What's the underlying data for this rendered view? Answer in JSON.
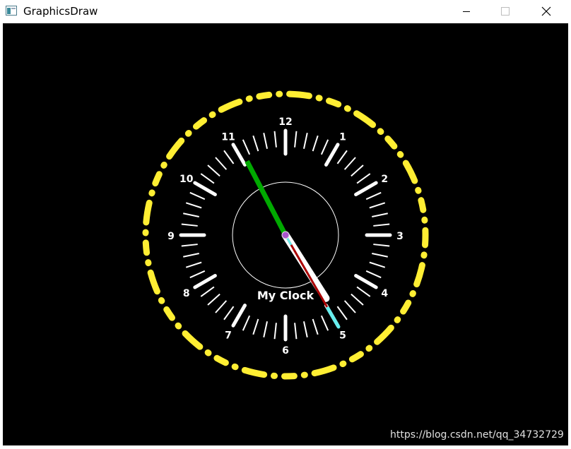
{
  "window": {
    "title": "GraphicsDraw",
    "icon": "app-window-icon",
    "controls": [
      "minimize-icon",
      "maximize-icon",
      "close-icon"
    ]
  },
  "clock": {
    "label": "My Clock",
    "numerals": [
      "12",
      "1",
      "2",
      "3",
      "4",
      "5",
      "6",
      "7",
      "8",
      "9",
      "10",
      "11"
    ],
    "time": {
      "hour": 4,
      "minute": 55,
      "second": 25
    },
    "colors": {
      "outer_ring": "#ffee33",
      "ticks": "#ffffff",
      "hour_hand": "#ffffff",
      "minute_hand": "#00aa00",
      "second_hand": "#aa0000",
      "second_tip": "#66eeee",
      "center": "#aa55cc",
      "inner_circle": "#ffffff"
    }
  },
  "watermark": "https://blog.csdn.net/qq_34732729"
}
